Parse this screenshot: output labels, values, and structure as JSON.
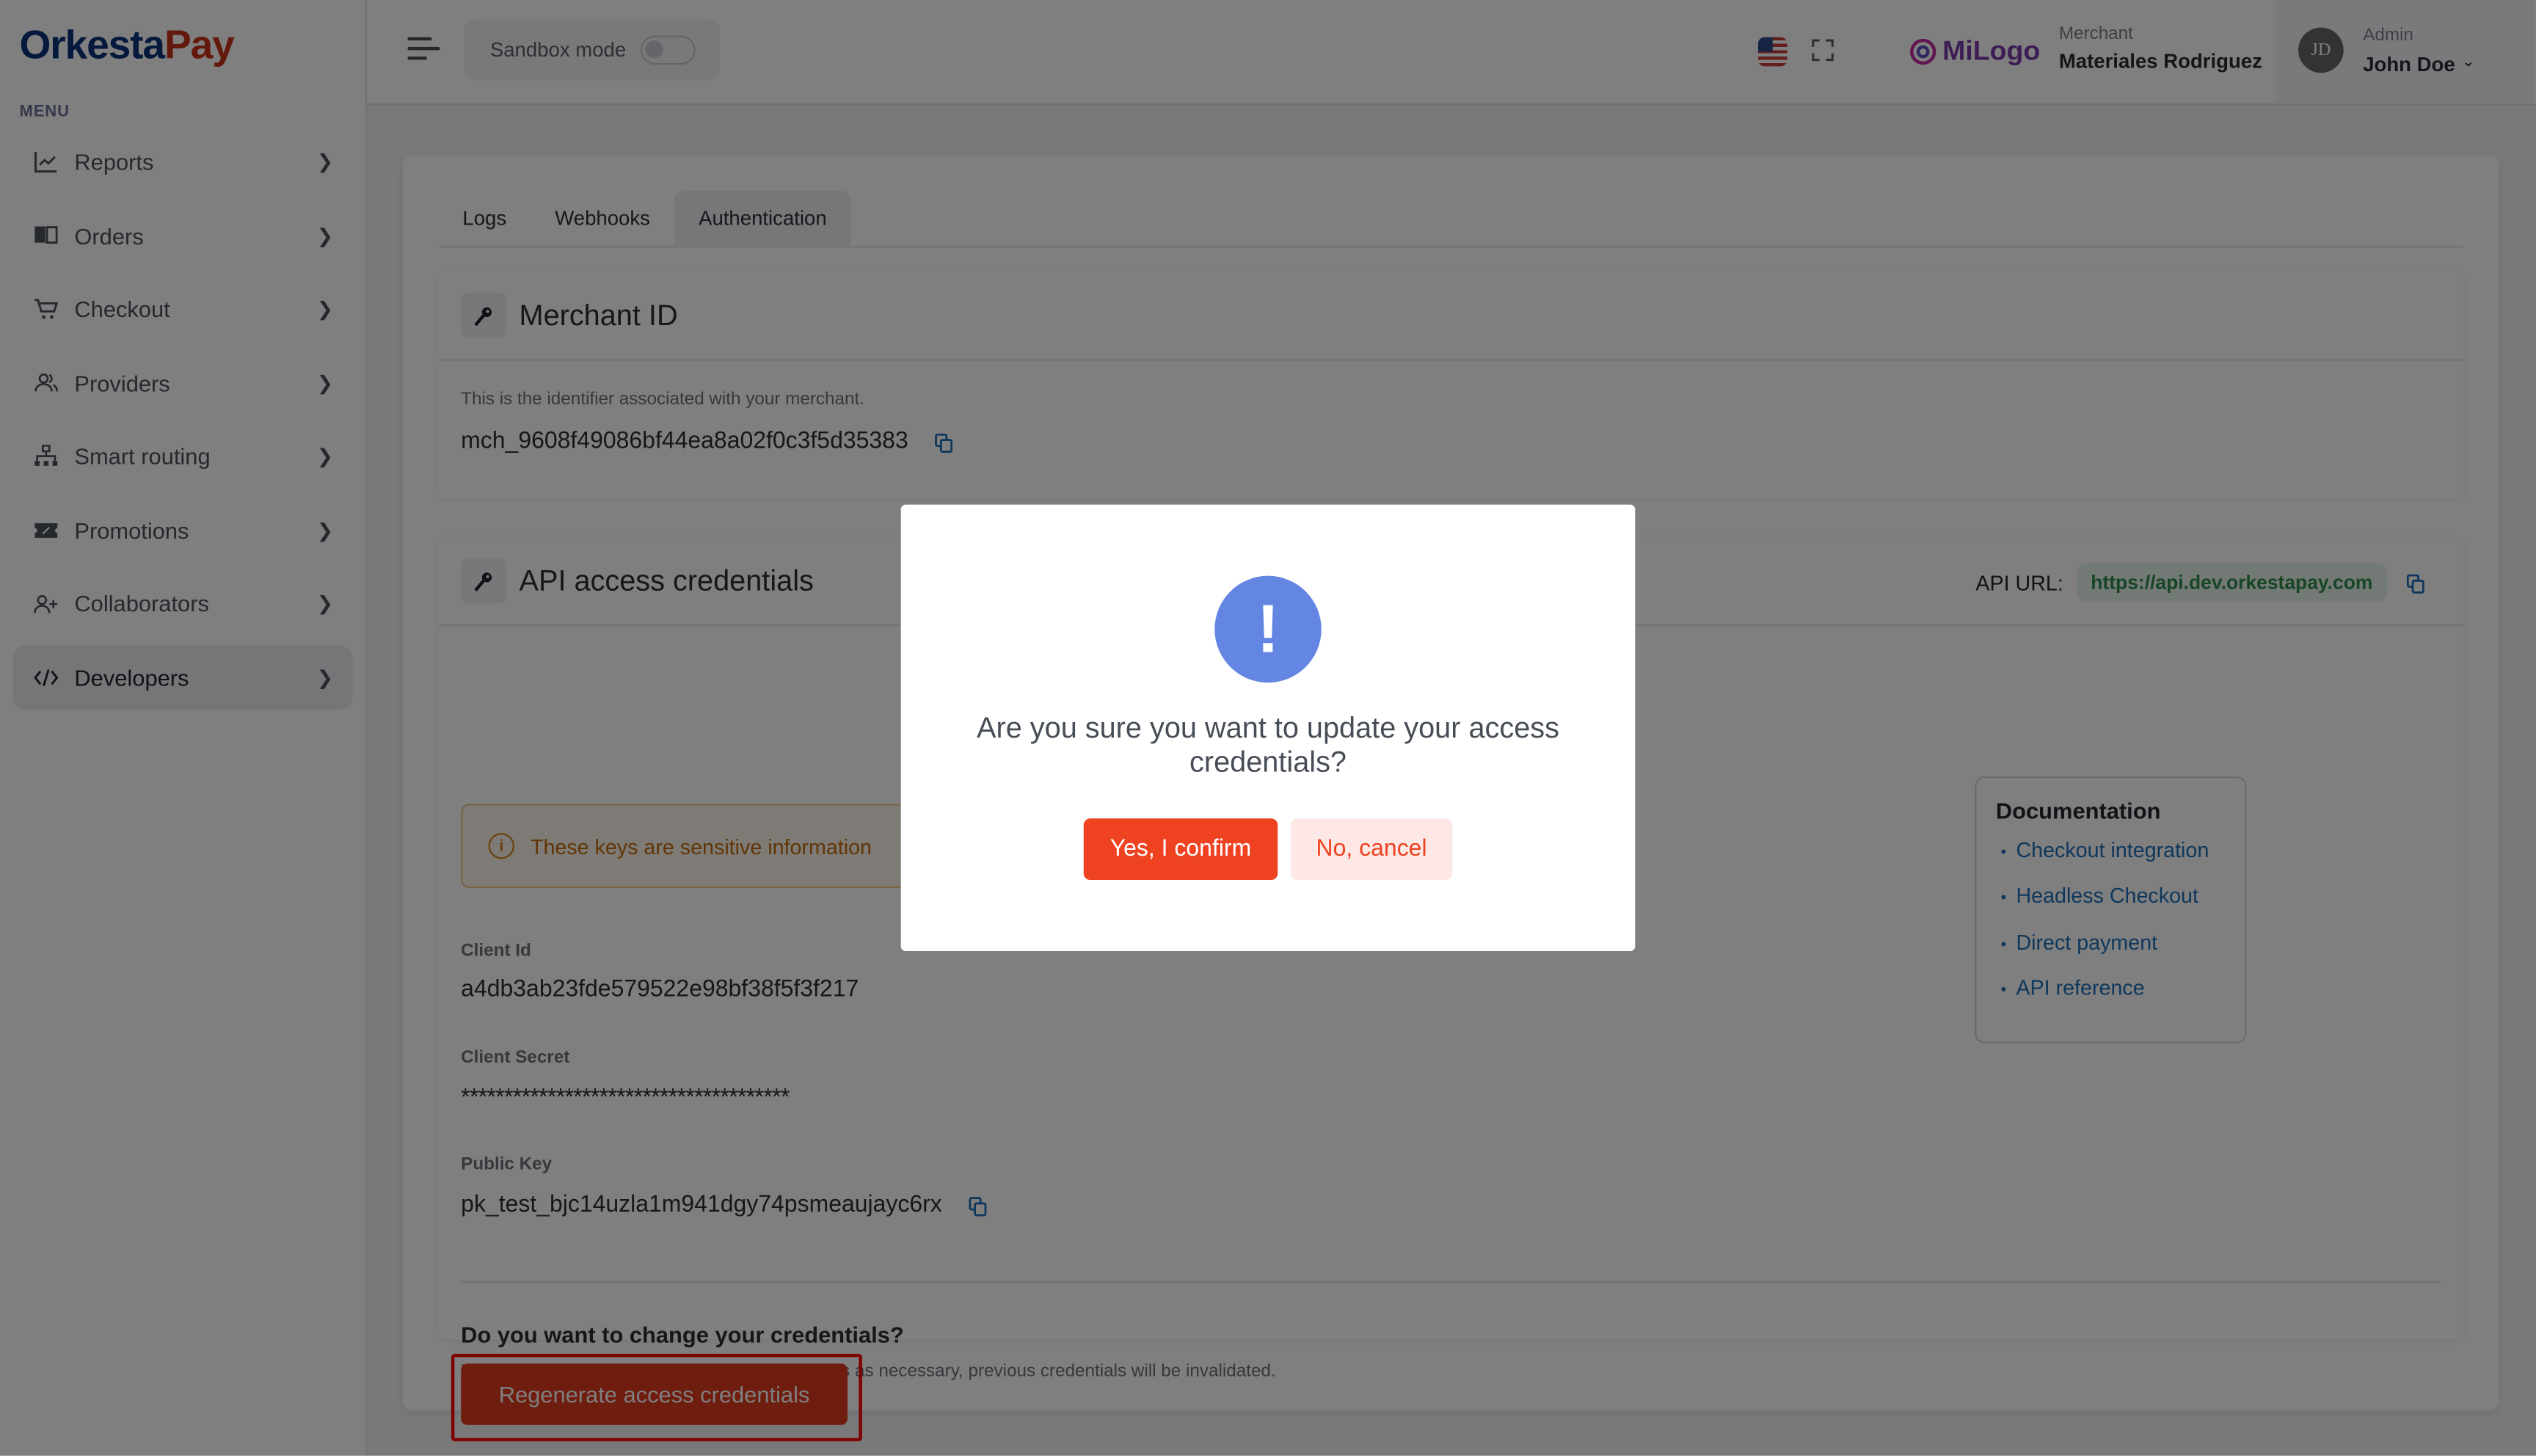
{
  "app": {
    "logo_part1": "Orkesta",
    "logo_part2": "Pay",
    "menu_label": "MENU"
  },
  "sidebar": {
    "items": [
      {
        "label": "Reports",
        "icon": "chart-line-icon",
        "active": false
      },
      {
        "label": "Orders",
        "icon": "book-open-icon",
        "active": false
      },
      {
        "label": "Checkout",
        "icon": "cart-icon",
        "active": false
      },
      {
        "label": "Providers",
        "icon": "users-icon",
        "active": false
      },
      {
        "label": "Smart routing",
        "icon": "sitemap-icon",
        "active": false
      },
      {
        "label": "Promotions",
        "icon": "ticket-percent-icon",
        "active": false
      },
      {
        "label": "Collaborators",
        "icon": "user-plus-icon",
        "active": false
      },
      {
        "label": "Developers",
        "icon": "code-icon",
        "active": true
      }
    ]
  },
  "header": {
    "sandbox_label": "Sandbox mode",
    "sandbox_enabled": false,
    "language": "en-US",
    "brand_logo_text": "MiLogo",
    "merchant_label": "Merchant",
    "merchant_name": "Materiales Rodriguez",
    "user_role": "Admin",
    "user_name": "John Doe",
    "user_initials": "JD"
  },
  "tabs": [
    {
      "label": "Logs",
      "active": false
    },
    {
      "label": "Webhooks",
      "active": false
    },
    {
      "label": "Authentication",
      "active": true
    }
  ],
  "merchant_panel": {
    "title": "Merchant ID",
    "description": "This is the identifier associated with your merchant.",
    "merchant_id": "mch_9608f49086bf44ea8a02f0c3f5d35383"
  },
  "credentials_panel": {
    "title": "API access credentials",
    "api_url_label": "API URL:",
    "api_url": "https://api.dev.orkestapay.com",
    "warning": "These keys are sensitive information",
    "client_id_label": "Client Id",
    "client_id": "a4db3ab23fde579522e98bf38f5f3f217",
    "client_secret_label": "Client Secret",
    "client_secret": "**************************************",
    "public_key_label": "Public Key",
    "public_key": "pk_test_bjc14uzla1m941dgy74psmeaujayc6rx",
    "docs": {
      "title": "Documentation",
      "links": [
        "Checkout integration",
        "Headless Checkout",
        "Direct payment",
        "API reference"
      ]
    },
    "change_title": "Do you want to change your credentials?",
    "change_description": "You can generate your credentials as many times as necessary, previous credentials will be invalidated.",
    "regenerate_label": "Regenerate access credentials"
  },
  "modal": {
    "icon": "exclamation-icon",
    "question": "Are you sure you want to update your access credentials?",
    "confirm_label": "Yes, I confirm",
    "cancel_label": "No, cancel"
  },
  "colors": {
    "brand_blue": "#0a3278",
    "brand_red": "#c8321a",
    "confirm": "#ee4220",
    "alert_icon": "#6486e3",
    "link": "#1f6fb8",
    "api_url": "#2e8b4a",
    "highlight": "#ff0000"
  }
}
